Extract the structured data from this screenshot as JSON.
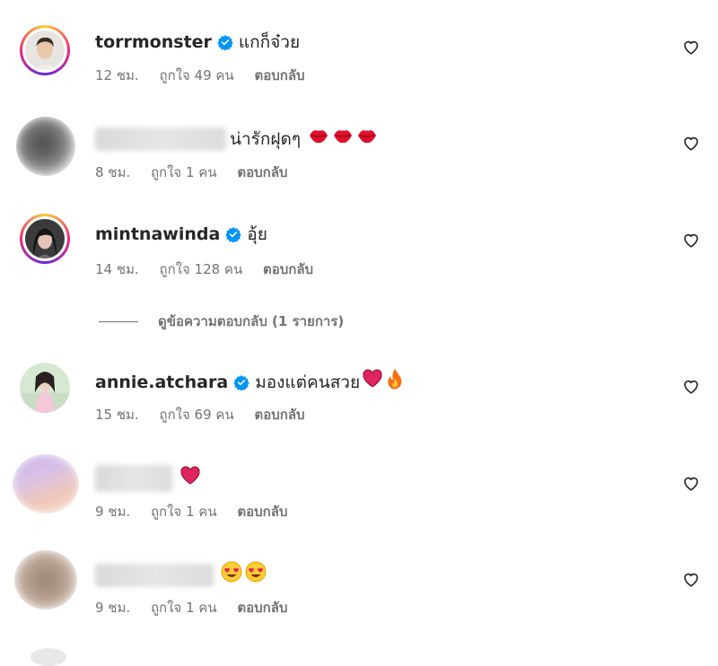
{
  "comments": [
    {
      "username": "torrmonster",
      "verified": true,
      "text": "แกก็จ๋วย",
      "time": "12 ชม.",
      "likes": "ถูกใจ 49 คน",
      "reply": "ตอบกลับ"
    },
    {
      "username": "",
      "verified": false,
      "text": "น่ารักฝุดๆ",
      "emoji": [
        "lips-emoji",
        "lips-emoji",
        "lips-emoji"
      ],
      "time": "8 ชม.",
      "likes": "ถูกใจ 1 คน",
      "reply": "ตอบกลับ"
    },
    {
      "username": "mintnawinda",
      "verified": true,
      "text": "อุ้ย",
      "time": "14 ชม.",
      "likes": "ถูกใจ 128 คน",
      "reply": "ตอบกลับ",
      "view_replies": "ดูข้อความตอบกลับ (1 รายการ)"
    },
    {
      "username": "annie.atchara",
      "verified": true,
      "text": "มองแต่คนสวย",
      "emoji": [
        "red-heart-emoji",
        "fire-emoji"
      ],
      "time": "15 ชม.",
      "likes": "ถูกใจ 69 คน",
      "reply": "ตอบกลับ"
    },
    {
      "username": "",
      "verified": false,
      "text": "",
      "emoji": [
        "red-heart-emoji"
      ],
      "time": "9 ชม.",
      "likes": "ถูกใจ 1 คน",
      "reply": "ตอบกลับ"
    },
    {
      "username": "",
      "verified": false,
      "text": "",
      "emoji": [
        "heart-eyes-emoji",
        "heart-eyes-emoji"
      ],
      "time": "9 ชม.",
      "likes": "ถูกใจ 1 คน",
      "reply": "ตอบกลับ"
    }
  ],
  "colors": {
    "verified": "#0095f6",
    "meta_text": "#737373",
    "primary_text": "#262626",
    "heart_red": "#e0245e"
  },
  "icons": {
    "like": "heart-outline-icon",
    "verified": "verified-badge-icon"
  }
}
